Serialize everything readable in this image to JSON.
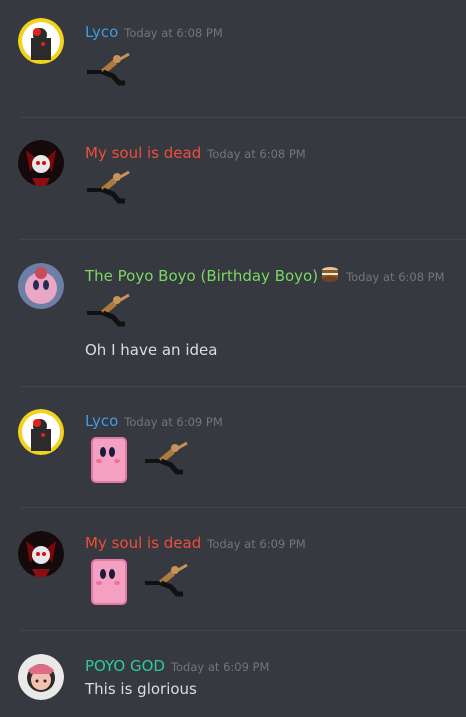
{
  "messages": [
    {
      "author": "Lyco",
      "color": "#3b9ee4",
      "time": "Today at 6:08 PM",
      "emojis": [
        "kick"
      ],
      "text": ""
    },
    {
      "author": "My soul is dead",
      "color": "#f04d3b",
      "time": "Today at 6:08 PM",
      "emojis": [
        "kick"
      ],
      "text": ""
    },
    {
      "author": "The Poyo Boyo (Birthday Boyo)",
      "color": "#7bd862",
      "time": "Today at 6:08 PM",
      "emojis": [
        "kick"
      ],
      "text": "Oh I have an idea"
    },
    {
      "author": "Lyco",
      "color": "#3b9ee4",
      "time": "Today at 6:09 PM",
      "emojis": [
        "kirby-block",
        "kick"
      ],
      "text": ""
    },
    {
      "author": "My soul is dead",
      "color": "#f04d3b",
      "time": "Today at 6:09 PM",
      "emojis": [
        "kirby-block",
        "kick"
      ],
      "text": ""
    },
    {
      "author": "POYO GOD",
      "color": "#2ecc9a",
      "time": "Today at 6:09 PM",
      "emojis": [],
      "text": "This is glorious"
    }
  ],
  "colors": {
    "background": "#36393f",
    "timestamp": "#72767d",
    "text": "#dcddde"
  }
}
